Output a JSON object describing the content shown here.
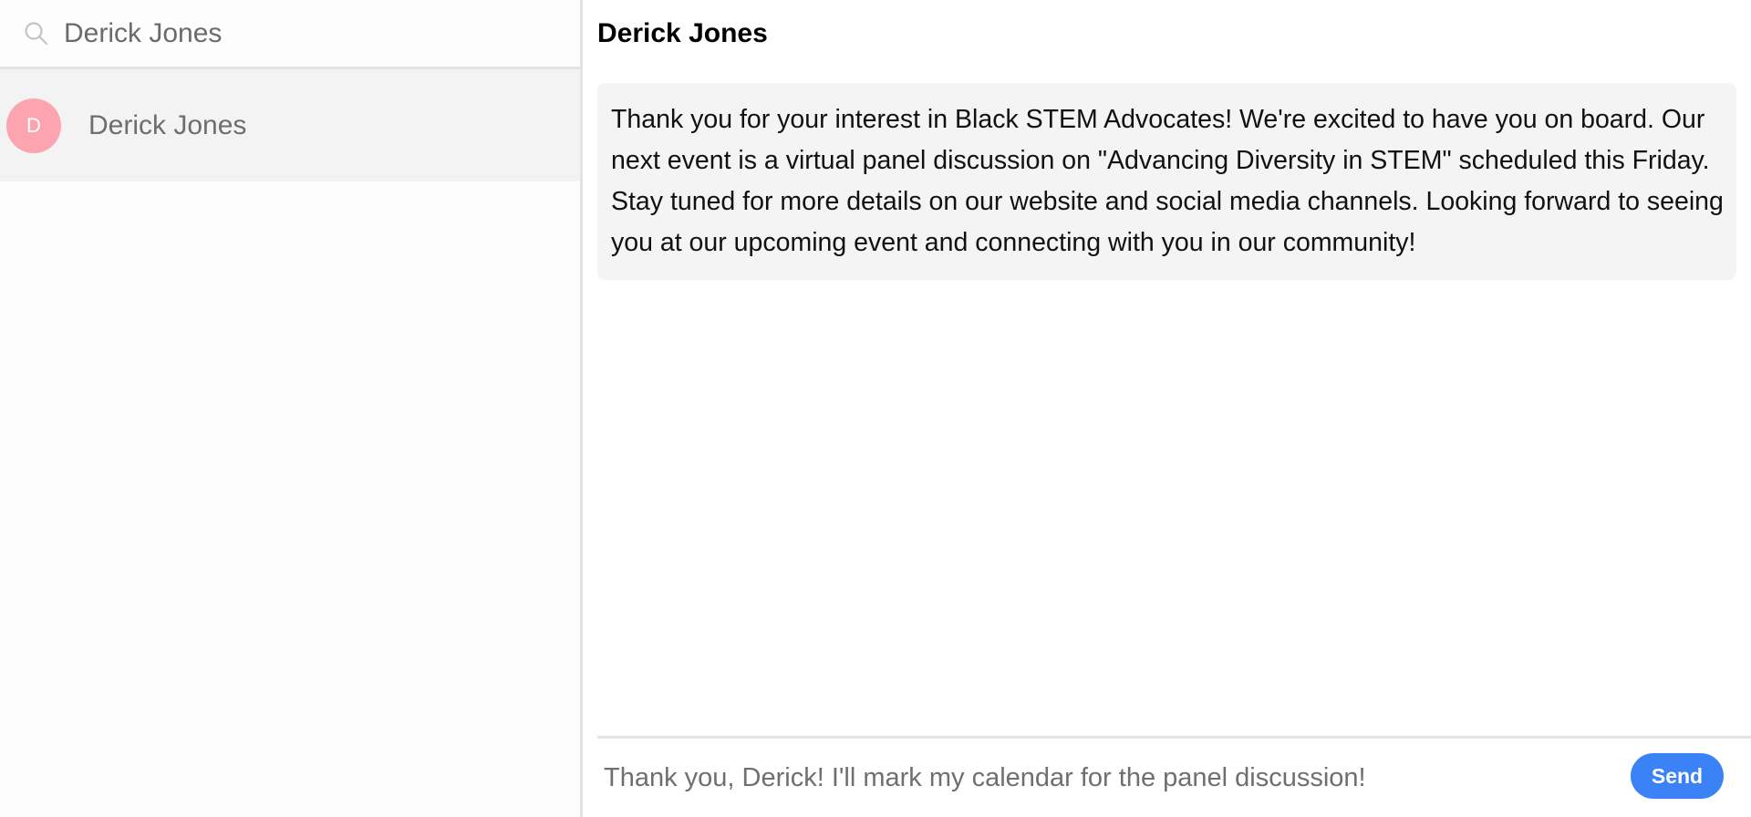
{
  "sidebar": {
    "search": {
      "icon": "search-icon",
      "value": "Derick Jones",
      "placeholder": ""
    },
    "contacts": [
      {
        "avatar_initial": "D",
        "avatar_color": "#fca5b0",
        "name": "Derick Jones",
        "selected": true
      }
    ]
  },
  "chat": {
    "header_title": "Derick Jones",
    "messages": [
      {
        "text": "Thank you for your interest in Black STEM Advocates! We're excited to have you on board. Our next event is a virtual panel discussion on \"Advancing Diversity in STEM\" scheduled this Friday. Stay tuned for more details on our website and social media channels. Looking forward to seeing you at our upcoming event and connecting with you in our community!"
      }
    ],
    "composer": {
      "value": "Thank you, Derick! I'll mark my calendar for the panel discussion!",
      "send_label": "Send",
      "send_color": "#3b82f6"
    }
  },
  "colors": {
    "selected_row_bg": "#f3f3f3",
    "bubble_bg": "#f4f4f4",
    "divider": "#e3e3e3"
  }
}
